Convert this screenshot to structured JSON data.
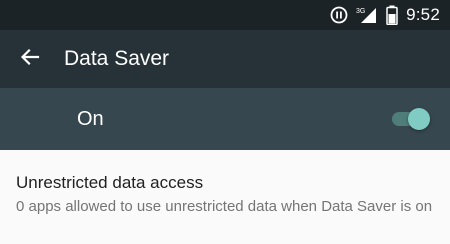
{
  "status_bar": {
    "network_label": "3G",
    "time": "9:52",
    "icons": [
      "pause-circle-icon",
      "signal-icon",
      "battery-icon"
    ]
  },
  "app_bar": {
    "title": "Data Saver",
    "back_icon": "arrow-back-icon"
  },
  "master_switch": {
    "label": "On",
    "checked": true
  },
  "preference": {
    "title": "Unrestricted data access",
    "summary": "0 apps allowed to use unrestricted data when Data Saver is on"
  },
  "colors": {
    "status_bar": "#1c2326",
    "app_bar": "#263238",
    "switch_bar": "#37474f",
    "accent": "#80cbc4",
    "background": "#fafafa"
  }
}
